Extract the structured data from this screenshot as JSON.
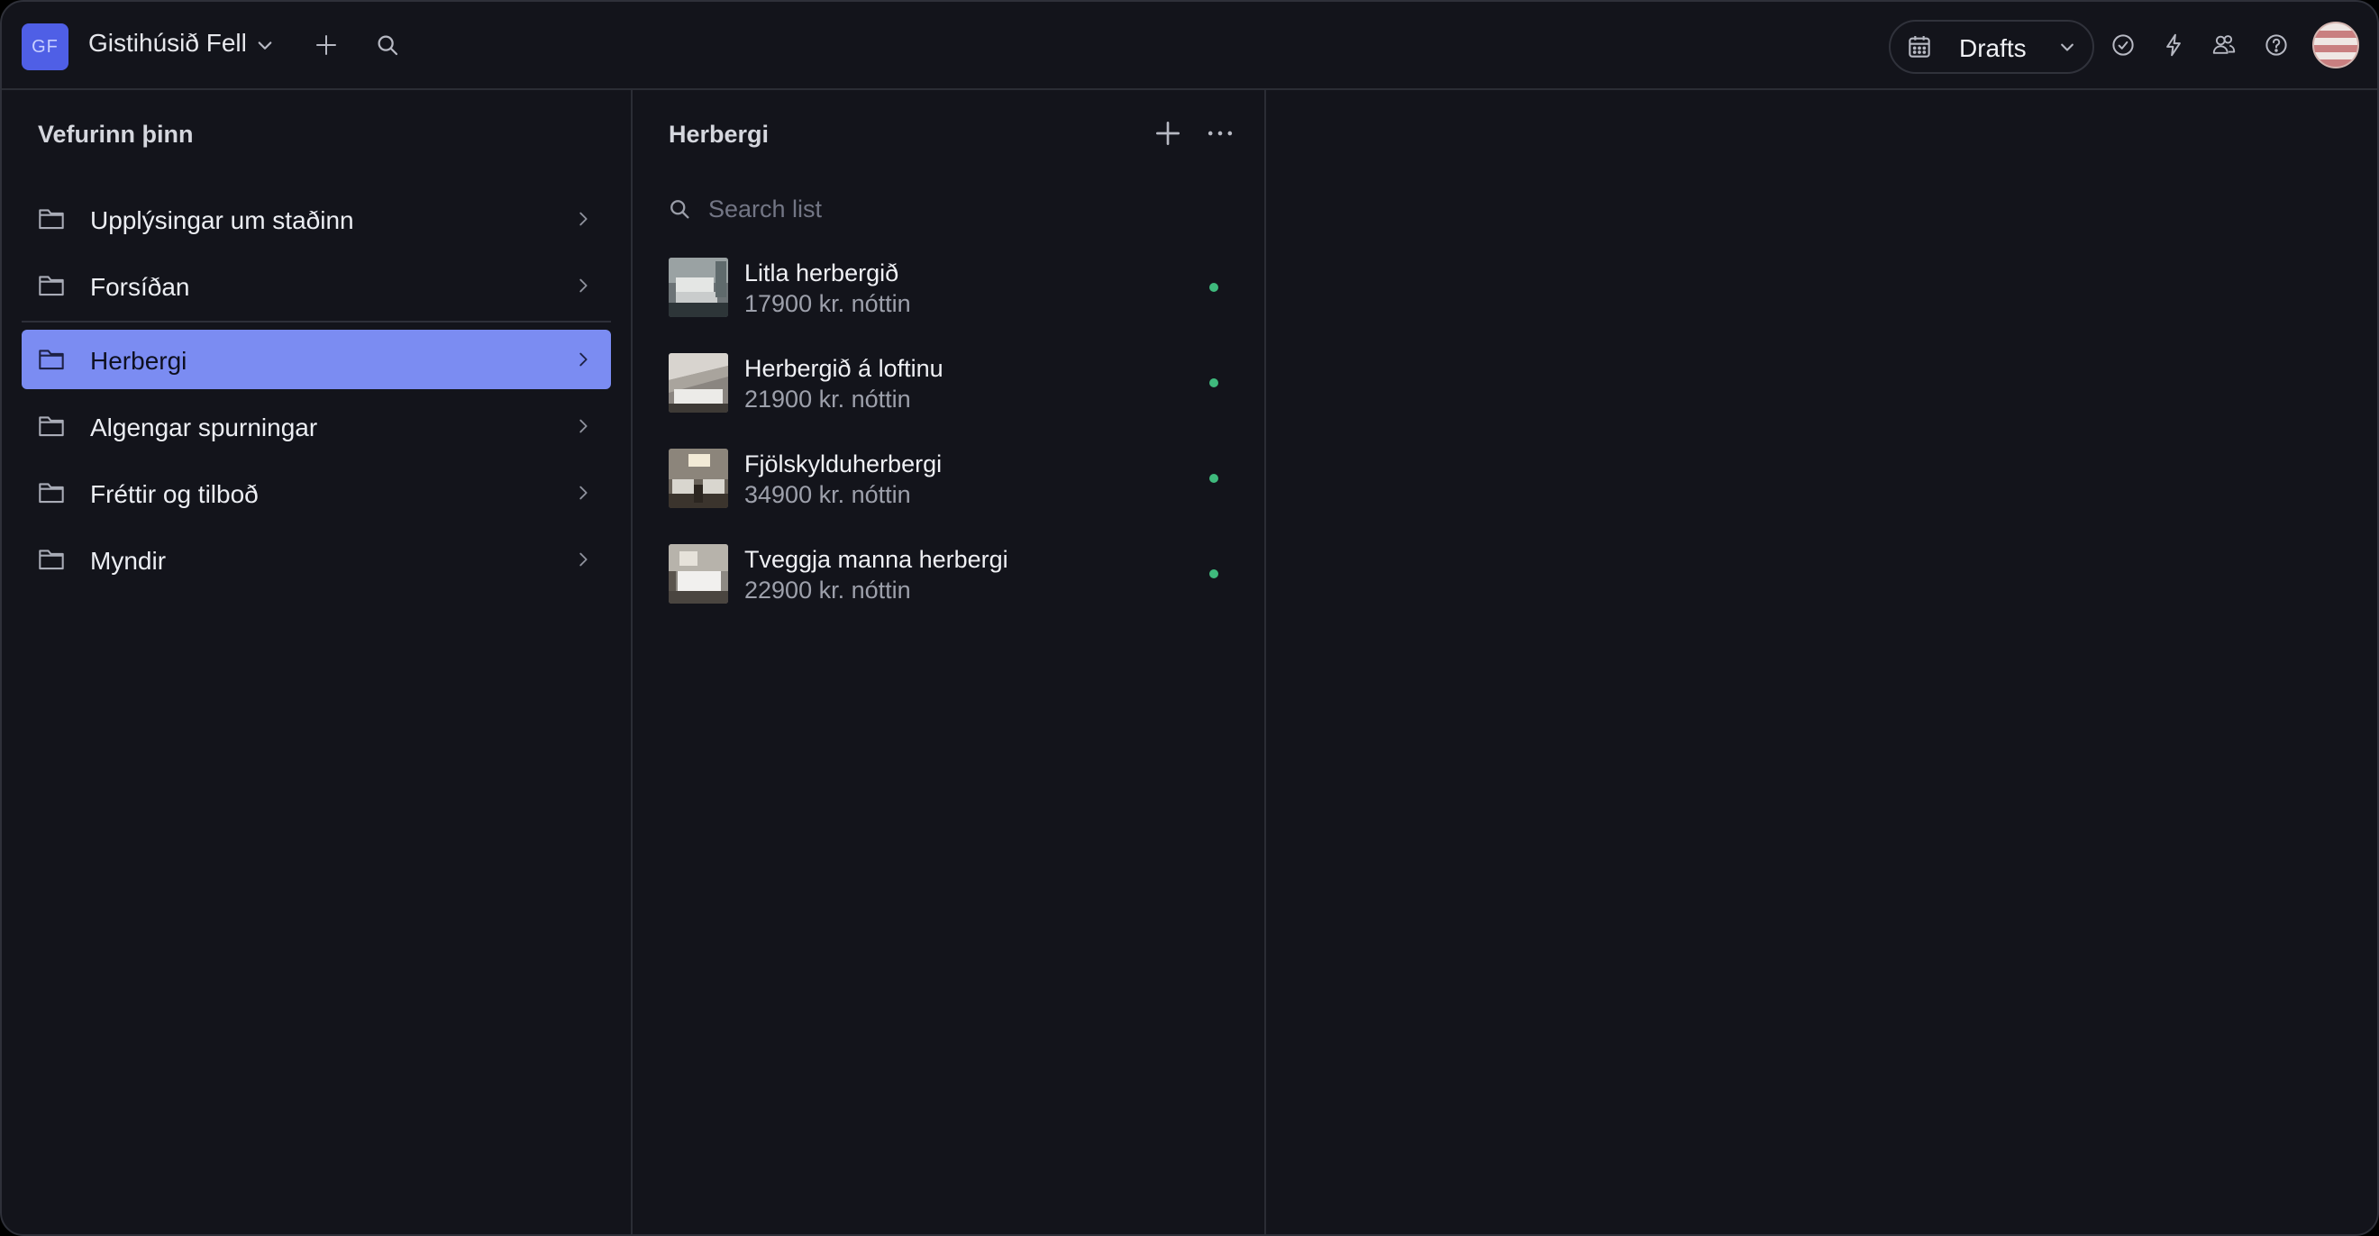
{
  "workspace": {
    "initials": "GF",
    "name": "Gistihúsið Fell"
  },
  "toolbar": {
    "perspective_label": "Drafts"
  },
  "structure": {
    "title": "Vefurinn þinn",
    "items": [
      {
        "label": "Upplýsingar um staðinn"
      },
      {
        "label": "Forsíðan"
      },
      {
        "label": "Herbergi"
      },
      {
        "label": "Algengar spurningar"
      },
      {
        "label": "Fréttir og tilboð"
      },
      {
        "label": "Myndir"
      }
    ]
  },
  "list": {
    "title": "Herbergi",
    "search_placeholder": "Search list",
    "items": [
      {
        "name": "Litla herbergið",
        "price": "17900 kr. nóttin"
      },
      {
        "name": "Herbergið á loftinu",
        "price": "21900 kr. nóttin"
      },
      {
        "name": "Fjölskylduherbergi",
        "price": "34900 kr. nóttin"
      },
      {
        "name": "Tveggja manna herbergi",
        "price": "22900 kr. nóttin"
      }
    ]
  },
  "colors": {
    "accent": "#7b8cf2",
    "workspace_badge": "#4f5fe6",
    "published_dot": "#3fba7d",
    "background": "#13141b"
  }
}
